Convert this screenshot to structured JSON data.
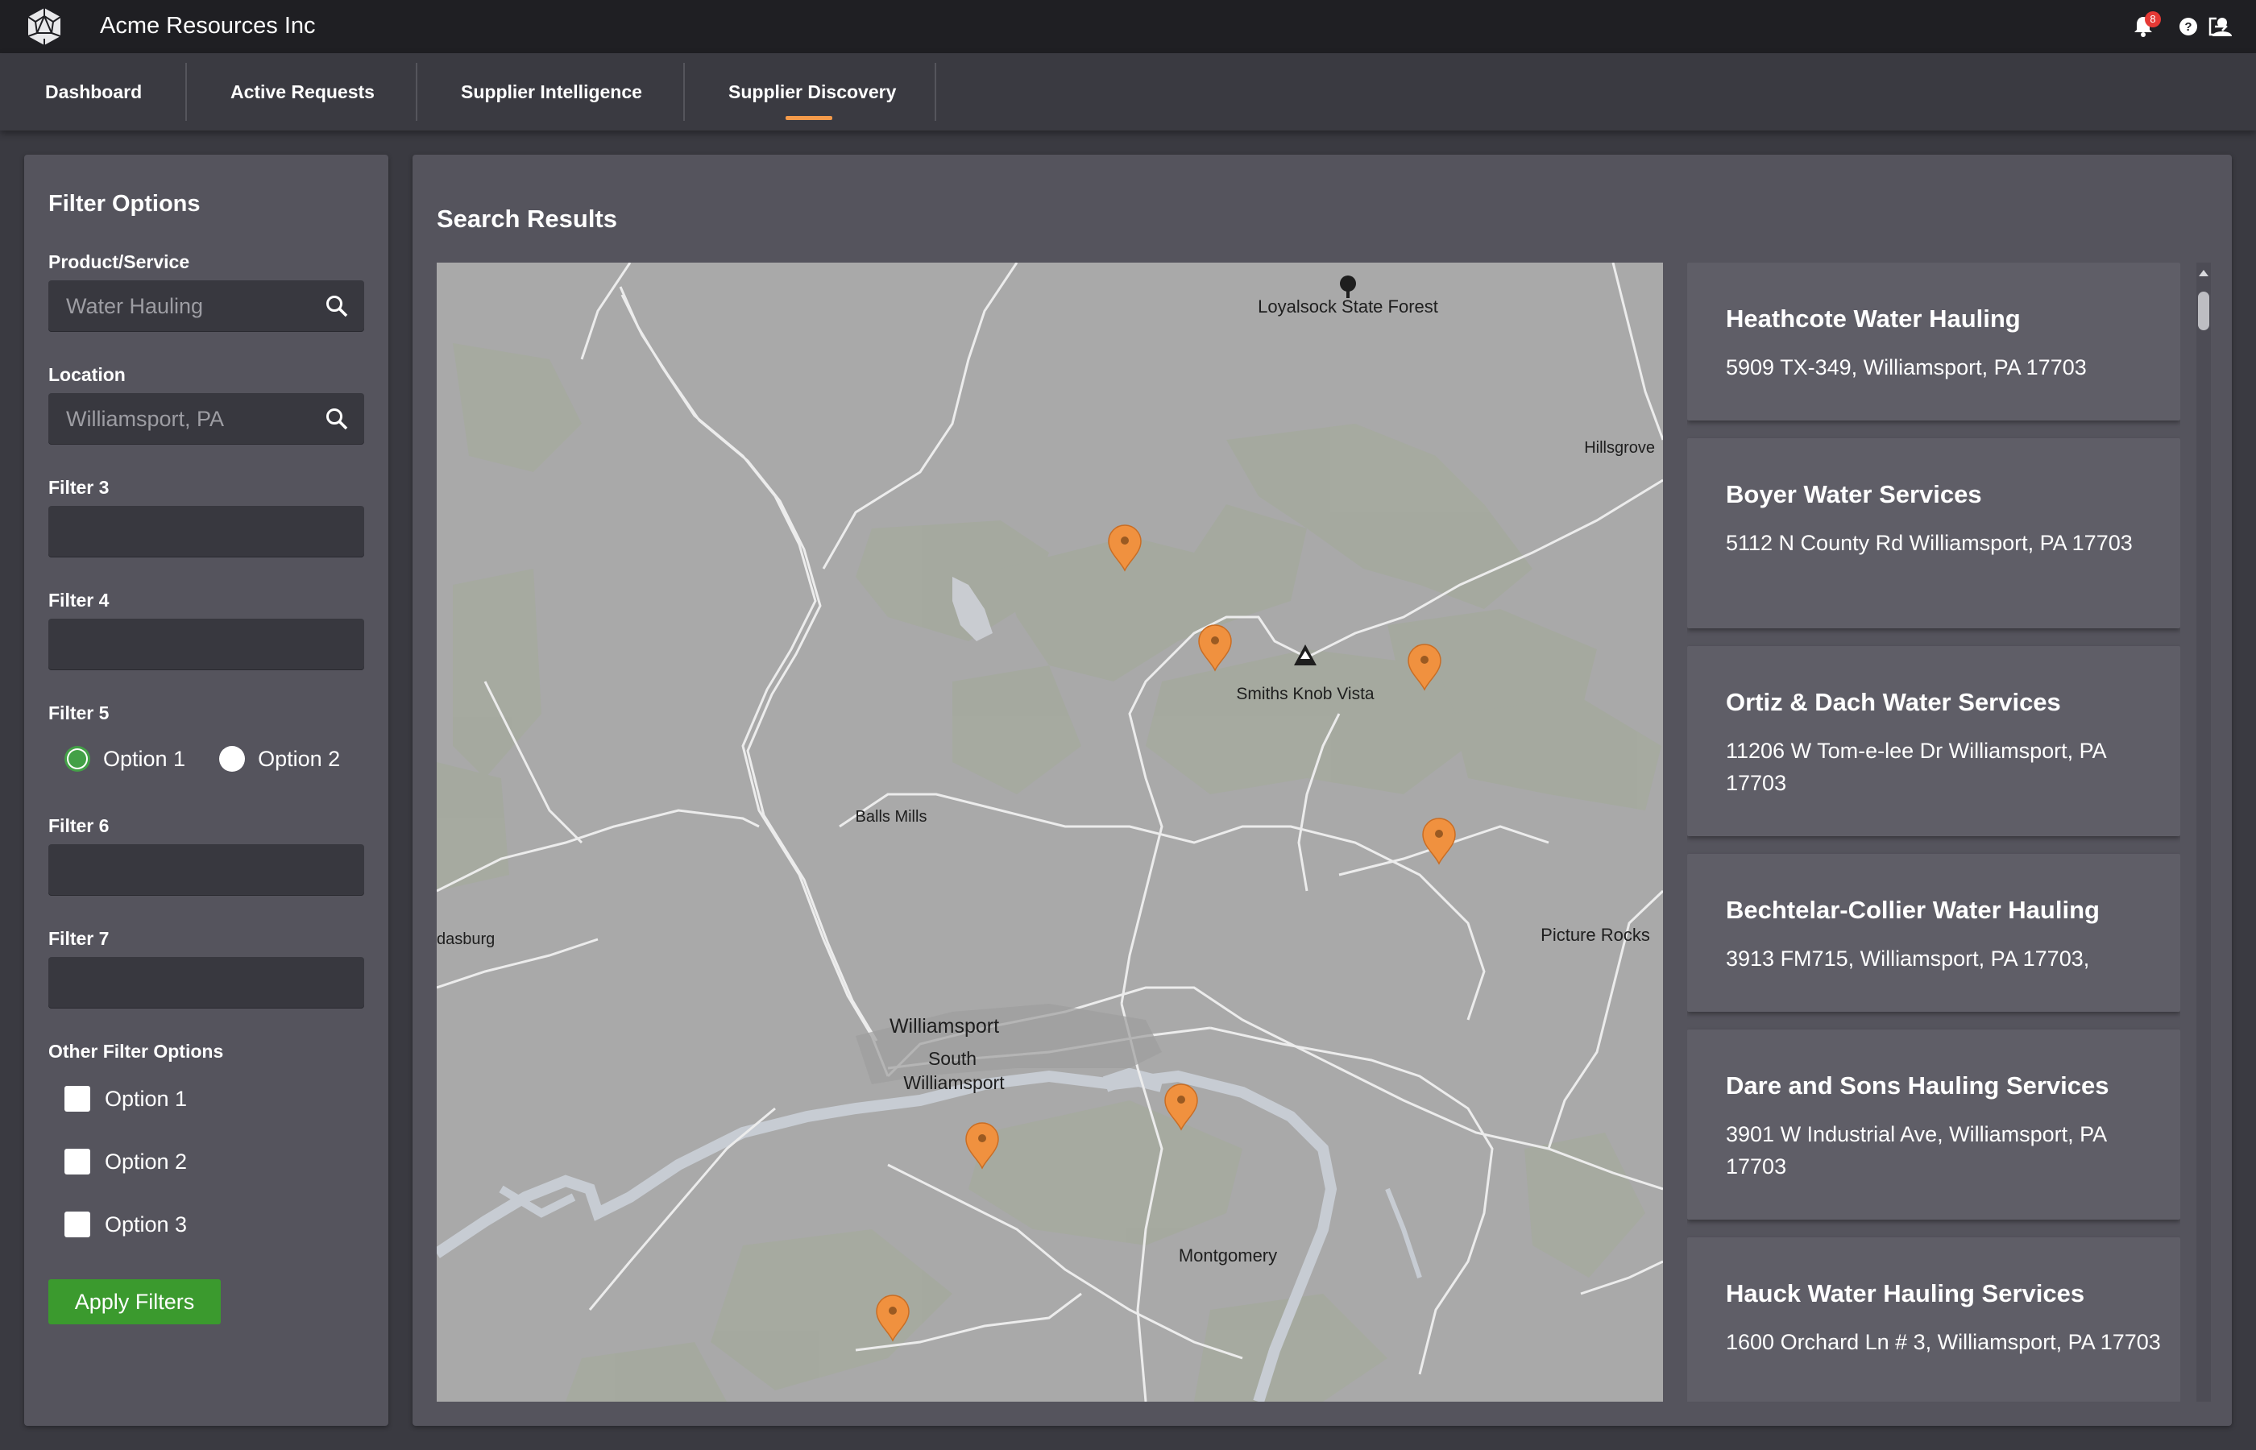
{
  "app": {
    "title": "Acme Resources Inc",
    "notification_count": "8"
  },
  "tabs": [
    {
      "label": "Dashboard"
    },
    {
      "label": "Active Requests"
    },
    {
      "label": "Supplier Intelligence"
    },
    {
      "label": "Supplier Discovery",
      "active": true
    }
  ],
  "filters": {
    "title": "Filter Options",
    "product": {
      "label": "Product/Service",
      "placeholder": "Water Hauling"
    },
    "location": {
      "label": "Location",
      "placeholder": "Williamsport, PA"
    },
    "filter3": {
      "label": "Filter 3"
    },
    "filter4": {
      "label": "Filter 4"
    },
    "filter5": {
      "label": "Filter 5",
      "options": [
        "Option 1",
        "Option 2"
      ],
      "selected": "Option 1"
    },
    "filter6": {
      "label": "Filter 6"
    },
    "filter7": {
      "label": "Filter 7"
    },
    "other": {
      "label": "Other Filter Options",
      "options": [
        "Option 1",
        "Option 2",
        "Option 3"
      ]
    },
    "apply_label": "Apply Filters"
  },
  "results": {
    "title": "Search Results",
    "items": [
      {
        "name": "Heathcote Water Hauling",
        "address": "5909 TX-349, Williamsport, PA 17703"
      },
      {
        "name": "Boyer Water Services",
        "address": "5112 N County Rd  Williamsport, PA 17703"
      },
      {
        "name": "Ortiz & Dach Water Services",
        "address": "11206 W Tom-e-lee Dr Williamsport, PA 17703"
      },
      {
        "name": "Bechtelar-Collier Water Hauling",
        "address": "3913 FM715, Williamsport, PA 17703,"
      },
      {
        "name": "Dare and Sons Hauling Services",
        "address": "3901 W Industrial Ave, Williamsport, PA 17703"
      },
      {
        "name": "Hauck Water Hauling Services",
        "address": "1600 Orchard Ln # 3, Williamsport, PA 17703"
      }
    ]
  },
  "map": {
    "labels": {
      "forest": "Loyalsock State Forest",
      "hillsgrove": "Hillsgrove",
      "vista": "Smiths Knob Vista",
      "balls_mills": "Balls Mills",
      "dasburg": "dasburg",
      "picture_rocks": "Picture Rocks",
      "williamsport": "Williamsport",
      "south": "South",
      "south_williamsport": "Williamsport",
      "montgomery": "Montgomery"
    },
    "pin_color": "#f0913f"
  },
  "colors": {
    "accent": "#f39a4a",
    "apply": "#3b9a2e",
    "radio_selected": "#43a047"
  },
  "icons": [
    "app-logo-icon",
    "bell-icon",
    "help-icon",
    "user-icon",
    "logout-icon",
    "search-icon",
    "map-pin-icon",
    "tree-icon",
    "mountain-icon"
  ]
}
